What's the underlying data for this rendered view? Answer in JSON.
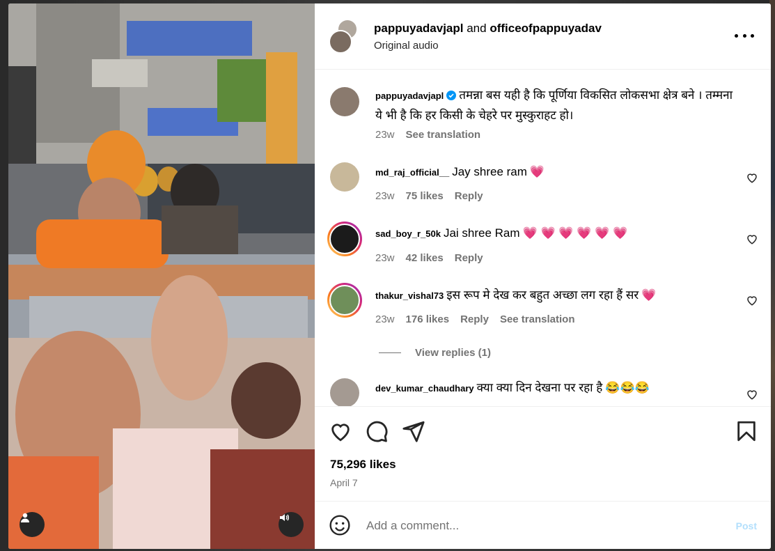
{
  "header": {
    "user1": "pappuyadavjapl",
    "conjunction": "and",
    "user2": "officeofpappuyadav",
    "audio": "Original audio"
  },
  "caption": {
    "username": "pappuyadavjapl",
    "text": "तमन्ना बस यही है कि पूर्णिया विकसित लोकसभा क्षेत्र बने । तम्मना ये भी है कि हर किसी के चेहरे पर मुस्कुराहट हो।",
    "time": "23w",
    "see_translation": "See translation"
  },
  "comments": [
    {
      "username": "md_raj_official__",
      "text": "Jay shree ram",
      "emoji": "💗",
      "time": "23w",
      "likes": "75 likes",
      "reply": "Reply"
    },
    {
      "username": "sad_boy_r_50k",
      "text": "Jai shree Ram",
      "emoji": "💗 💗 💗 💗 💗 💗",
      "time": "23w",
      "likes": "42 likes",
      "reply": "Reply"
    },
    {
      "username": "thakur_vishal73",
      "text": "इस रूप मे देख कर बहुत अच्छा लग रहा हैं सर",
      "emoji": "💗",
      "time": "23w",
      "likes": "176 likes",
      "reply": "Reply",
      "see_translation": "See translation"
    },
    {
      "username": "dev_kumar_chaudhary",
      "text": "क्या क्या दिन देखना पर रहा है",
      "emoji": "😂😂😂"
    }
  ],
  "view_replies": "View replies (1)",
  "likes": "75,296 likes",
  "date": "April 7",
  "add_comment": {
    "placeholder": "Add a comment...",
    "post": "Post"
  },
  "icons": {
    "like": "heart-icon",
    "comment": "comment-icon",
    "share": "paper-plane-icon",
    "save": "bookmark-icon",
    "more": "more-horizontal-icon",
    "emoji": "emoji-smile-icon",
    "user": "user-icon",
    "audio": "speaker-icon",
    "verified": "verified-badge-icon"
  },
  "colors": {
    "post_disabled": "#b2dffc",
    "verified": "#0095f6",
    "meta_text": "#737373"
  }
}
